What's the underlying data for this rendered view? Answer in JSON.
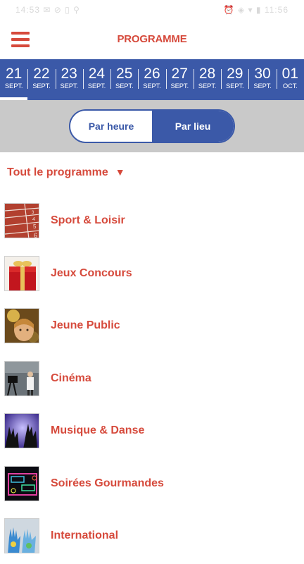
{
  "status": {
    "left": "14:53 ✉ ⊘ ▯ ⚲",
    "right": "⏰ ◈ ▾ ▮ 11:56"
  },
  "appbar": {
    "title": "PROGRAMME"
  },
  "dates": [
    {
      "day": "21",
      "month": "SEPT."
    },
    {
      "day": "22",
      "month": "SEPT."
    },
    {
      "day": "23",
      "month": "SEPT."
    },
    {
      "day": "24",
      "month": "SEPT."
    },
    {
      "day": "25",
      "month": "SEPT."
    },
    {
      "day": "26",
      "month": "SEPT."
    },
    {
      "day": "27",
      "month": "SEPT."
    },
    {
      "day": "28",
      "month": "SEPT."
    },
    {
      "day": "29",
      "month": "SEPT."
    },
    {
      "day": "30",
      "month": "SEPT."
    },
    {
      "day": "01",
      "month": "OCT."
    }
  ],
  "toggle": {
    "option1": "Par heure",
    "option2": "Par lieu",
    "selected": "Par lieu"
  },
  "filter": {
    "label": "Tout le programme",
    "arrow": "▼"
  },
  "categories": [
    {
      "label": "Sport & Loisir",
      "icon": "running-track-thumbnail"
    },
    {
      "label": "Jeux Concours",
      "icon": "gift-box-thumbnail"
    },
    {
      "label": "Jeune Public",
      "icon": "child-thumbnail"
    },
    {
      "label": "Cinéma",
      "icon": "film-set-thumbnail"
    },
    {
      "label": "Musique & Danse",
      "icon": "concert-hands-thumbnail"
    },
    {
      "label": "Soirées Gourmandes",
      "icon": "neon-sign-thumbnail"
    },
    {
      "label": "International",
      "icon": "painted-hands-thumbnail"
    }
  ],
  "colors": {
    "accent_red": "#d64a3c",
    "brand_blue": "#3b59a8",
    "toggle_bg": "#c9c9c9"
  }
}
